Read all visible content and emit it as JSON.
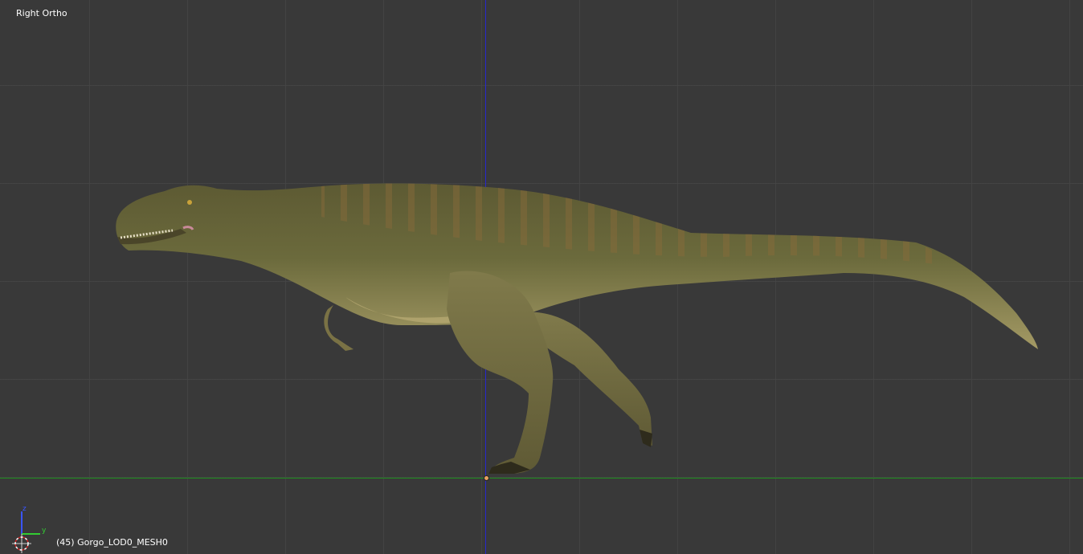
{
  "viewport": {
    "view_name": "Right Ortho",
    "object_info": "(45) Gorgo_LOD0_MESH0"
  },
  "gizmo": {
    "z_label": "z",
    "y_label": "y"
  },
  "colors": {
    "background": "#393939",
    "grid": "#444444",
    "z_axis": "#2828cc",
    "y_axis": "#1f8c1f",
    "text": "#ffffff"
  }
}
